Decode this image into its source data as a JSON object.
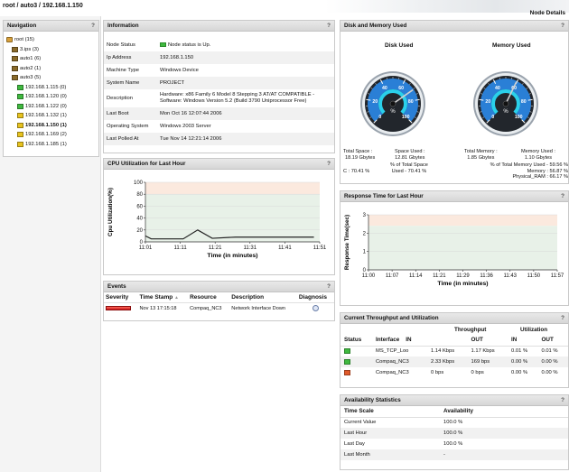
{
  "breadcrumb": "root / auto3 / 192.168.1.150",
  "node_details_label": "Node Details",
  "navigation": {
    "title": "Navigation",
    "help": "?",
    "items": [
      {
        "label": "root (15)",
        "icon": "folder-icon",
        "level": 0
      },
      {
        "label": "3.ips (3)",
        "icon": "device-group-icon",
        "level": 1
      },
      {
        "label": "auto1 (6)",
        "icon": "device-group-icon",
        "level": 1
      },
      {
        "label": "auto2 (1)",
        "icon": "device-group-icon",
        "level": 1
      },
      {
        "label": "auto3 (5)",
        "icon": "device-group-icon",
        "level": 1
      },
      {
        "label": "192.168.1.115 (0)",
        "icon": "green-status-icon",
        "level": 2
      },
      {
        "label": "192.168.1.120 (0)",
        "icon": "green-status-icon",
        "level": 2
      },
      {
        "label": "192.168.1.122 (0)",
        "icon": "green-status-icon",
        "level": 2
      },
      {
        "label": "192.168.1.132 (1)",
        "icon": "yellow-status-icon",
        "level": 2
      },
      {
        "label": "192.168.1.150 (1)",
        "icon": "yellow-status-icon",
        "level": 2,
        "selected": true
      },
      {
        "label": "192.168.1.169 (2)",
        "icon": "yellow-status-icon",
        "level": 2
      },
      {
        "label": "192.168.1.185 (1)",
        "icon": "yellow-status-icon",
        "level": 2
      }
    ]
  },
  "information": {
    "title": "Information",
    "help": "?",
    "rows": [
      {
        "key": "Node Status",
        "value": "Node status is Up."
      },
      {
        "key": "Ip Address",
        "value": "192.168.1.150"
      },
      {
        "key": "Machine Type",
        "value": "Windows Device"
      },
      {
        "key": "System Name",
        "value": "PROJECT"
      },
      {
        "key": "Description",
        "value": "Hardware: x86 Family 6 Model 8 Stepping 3 AT/AT COMPATIBLE - Software: Windows Version 5.2 (Build 3790 Uniprocessor Free)"
      },
      {
        "key": "Last Boot",
        "value": "Mon Oct 16 12:07:44 2006"
      },
      {
        "key": "Operating System",
        "value": "Windows 2003 Server"
      },
      {
        "key": "Last Polled At",
        "value": "Tue Nov 14 12:21:14 2006"
      }
    ]
  },
  "cpu": {
    "title": "CPU Utilization for Last Hour",
    "help": "?",
    "chart_data": {
      "type": "line",
      "xlabel": "Time (in minutes)",
      "ylabel": "Cpu Utilization(%)",
      "ylim": [
        0,
        100
      ],
      "yticks": [
        "0",
        "20",
        "40",
        "60",
        "80",
        "100"
      ],
      "xticks": [
        "11:01",
        "11:11",
        "11:21",
        "11:31",
        "11:41",
        "11:51"
      ],
      "series": [
        {
          "values": [
            {
              "x": 0,
              "y": 10
            },
            {
              "x": 2,
              "y": 5
            },
            {
              "x": 13,
              "y": 5
            },
            {
              "x": 18,
              "y": 20
            },
            {
              "x": 23,
              "y": 6
            },
            {
              "x": 31,
              "y": 8
            },
            {
              "x": 58,
              "y": 8
            }
          ]
        }
      ],
      "colors": {
        "line": "#222222",
        "band_low": "#e8f1e8",
        "band_high": "#fbe9de"
      }
    }
  },
  "events": {
    "title": "Events",
    "help": "?",
    "headers": {
      "severity": "Severity",
      "timestamp": "Time Stamp",
      "resource": "Resource",
      "description": "Description",
      "diagnosis": "Diagnosis"
    },
    "sort_indicator": "▲",
    "rows": [
      {
        "severity": "critical",
        "timestamp": "Nov 13 17:15:18",
        "resource": "Compaq_NC3",
        "description": "Network Interface Down",
        "diagnosis_icon": "diagnosis-icon"
      }
    ]
  },
  "disk_memory": {
    "title": "Disk and Memory Used",
    "help": "?",
    "disk": {
      "title": "Disk Used",
      "percent": 70.41,
      "total_label": "Total Space :",
      "total_value": "18.19 Gbytes",
      "used_label": "Space Used :",
      "used_value": "12.81 Gbytes",
      "c_line": "C : 70.41 %",
      "pct_line1": "% of Total Space",
      "pct_line2": "Used - 70.41 %",
      "gauge_ticks": [
        "0",
        "20",
        "40",
        "60",
        "80",
        "100"
      ]
    },
    "memory": {
      "title": "Memory Used",
      "percent": 59.56,
      "total_label": "Total Memory :",
      "total_value": "1.85 Gbytes",
      "used_label": "Memory Used :",
      "used_value": "1.10 Gbytes",
      "pct_line": "% of Total Memory Used - 59.56 %",
      "memory_line": "Memory : 56.87 %",
      "physical_line": "Physical_RAM : 66.17 %",
      "gauge_ticks": [
        "0",
        "20",
        "40",
        "60",
        "80",
        "100"
      ]
    }
  },
  "response": {
    "title": "Response Time for Last Hour",
    "help": "?",
    "chart_data": {
      "type": "line",
      "xlabel": "Time (in minutes)",
      "ylabel": "Response Time(sec)",
      "ylim": [
        0,
        3
      ],
      "yticks": [
        "0",
        "1",
        "2",
        "3"
      ],
      "xticks": [
        "11:00",
        "11:07",
        "11:14",
        "11:21",
        "11:29",
        "11:36",
        "11:43",
        "11:50",
        "11:57"
      ],
      "series": [],
      "colors": {
        "band_low": "#e8f1e8",
        "band_high": "#fbe9de"
      }
    }
  },
  "throughput": {
    "title": "Current Throughput and Utilization",
    "help": "?",
    "group_headers": {
      "throughput": "Throughput",
      "utilization": "Utilization"
    },
    "headers": {
      "status": "Status",
      "interface": "Interface",
      "in": "IN",
      "out": "OUT",
      "u_in": "IN",
      "u_out": "OUT"
    },
    "rows": [
      {
        "status": "ok",
        "interface": "MS_TCP_Loo",
        "in": "1.14 Kbps",
        "out": "1.17 Kbps",
        "u_in": "0.01 %",
        "u_out": "0.01 %"
      },
      {
        "status": "ok",
        "interface": "Compaq_NC3",
        "in": "2.33 Kbps",
        "out": "169 bps",
        "u_in": "0.00 %",
        "u_out": "0.00 %"
      },
      {
        "status": "down",
        "interface": "Compaq_NC3",
        "in": "0 bps",
        "out": "0 bps",
        "u_in": "0.00 %",
        "u_out": "0.00 %"
      }
    ]
  },
  "availability": {
    "title": "Availability Statistics",
    "help": "?",
    "headers": {
      "scale": "Time Scale",
      "availability": "Availability"
    },
    "rows": [
      {
        "scale": "Current Value",
        "value": "100.0 %"
      },
      {
        "scale": "Last Hour",
        "value": "100.0 %"
      },
      {
        "scale": "Last Day",
        "value": "100.0 %"
      },
      {
        "scale": "Last Month",
        "value": "-"
      }
    ]
  }
}
